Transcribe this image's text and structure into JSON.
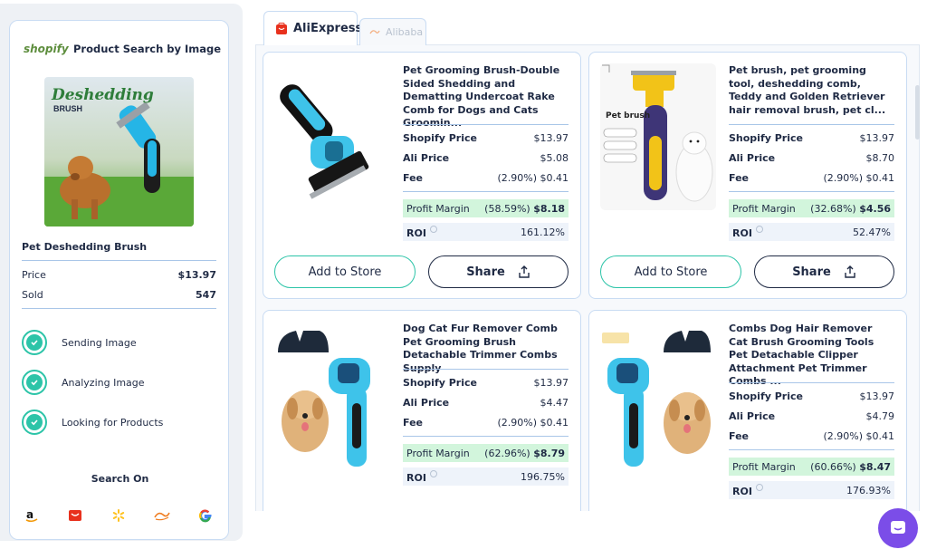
{
  "left": {
    "brand": "shopify",
    "title": "Product Search by Image",
    "image_text": {
      "line1": "Deshedding",
      "line2": "BRUSH"
    },
    "product_name": "Pet Deshedding Brush",
    "price_label": "Price",
    "price_value": "$13.97",
    "sold_label": "Sold",
    "sold_value": "547",
    "steps": [
      "Sending Image",
      "Analyzing Image",
      "Looking for Products"
    ],
    "search_on": "Search On",
    "engines": [
      "amazon-icon",
      "aliexpress-icon",
      "walmart-icon",
      "alibaba-icon",
      "google-icon"
    ]
  },
  "tabs": [
    {
      "label": "AliExpress",
      "active": true
    },
    {
      "label": "Alibaba",
      "active": false
    }
  ],
  "labels": {
    "shopify_price": "Shopify Price",
    "ali_price": "Ali Price",
    "fee": "Fee",
    "profit_margin": "Profit Margin",
    "roi": "ROI",
    "add_to_store": "Add to Store",
    "share": "Share"
  },
  "products": [
    {
      "title": "Pet Grooming Brush-Double Sided Shedding and Dematting Undercoat Rake Comb for Dogs and Cats Groomin...",
      "shopify_price": "$13.97",
      "ali_price": "$5.08",
      "fee": "(2.90%) $0.41",
      "margin_pct": "(58.59%)",
      "margin_val": "$8.18",
      "roi": "161.12%"
    },
    {
      "title": "Pet brush, pet grooming tool, deshedding comb, Teddy and Golden Retriever hair removal brush, pet cl...",
      "shopify_price": "$13.97",
      "ali_price": "$8.70",
      "fee": "(2.90%) $0.41",
      "margin_pct": "(32.68%)",
      "margin_val": "$4.56",
      "roi": "52.47%",
      "image_caption": "Pet brush"
    },
    {
      "title": "Dog Cat Fur Remover Comb Pet Grooming Brush Detachable Trimmer Combs Supply",
      "shopify_price": "$13.97",
      "ali_price": "$4.47",
      "fee": "(2.90%) $0.41",
      "margin_pct": "(62.96%)",
      "margin_val": "$8.79",
      "roi": "196.75%"
    },
    {
      "title": "Combs Dog Hair Remover Cat Brush Grooming Tools Pet Detachable Clipper Attachment Pet Trimmer Combs ...",
      "shopify_price": "$13.97",
      "ali_price": "$4.79",
      "fee": "(2.90%) $0.41",
      "margin_pct": "(60.66%)",
      "margin_val": "$8.47",
      "roi": "176.93%"
    }
  ],
  "colors": {
    "accent": "#2cc4a8",
    "profit_bg": "#d2f5dc",
    "chat": "#7b4de8",
    "brand_shopify": "#5e8e3e"
  }
}
